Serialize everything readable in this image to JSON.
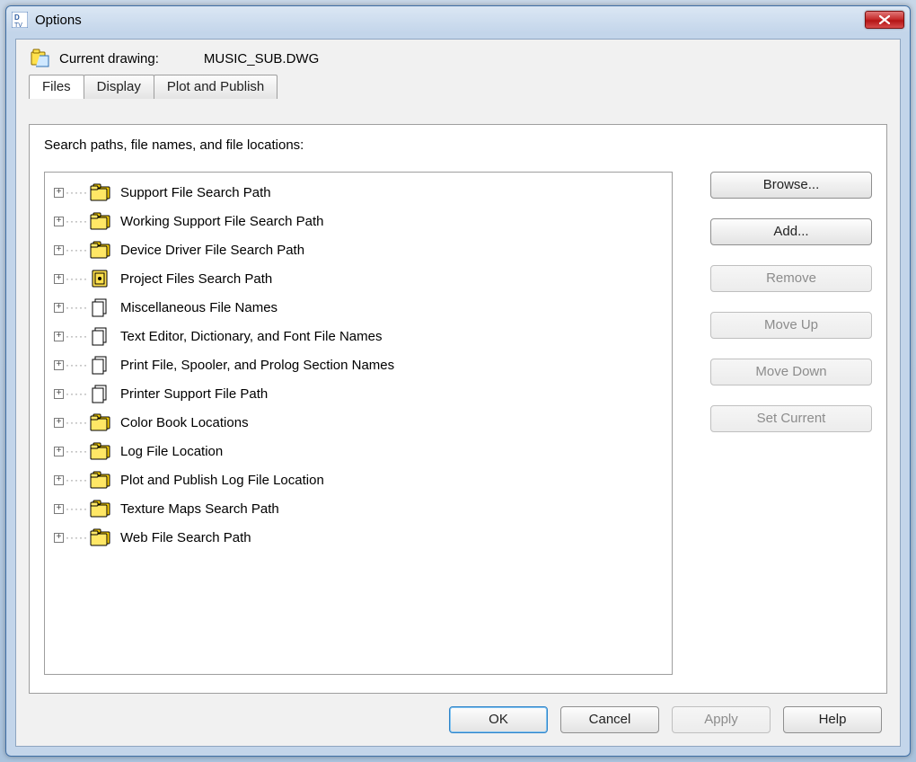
{
  "window": {
    "title": "Options"
  },
  "drawing": {
    "label": "Current drawing:",
    "name": "MUSIC_SUB.DWG"
  },
  "tabs": [
    {
      "label": "Files",
      "active": true
    },
    {
      "label": "Display",
      "active": false
    },
    {
      "label": "Plot and Publish",
      "active": false
    }
  ],
  "panel": {
    "header": "Search paths, file names, and file locations:"
  },
  "tree": [
    {
      "label": "Support File Search Path",
      "icon": "folder"
    },
    {
      "label": "Working Support File Search Path",
      "icon": "folder"
    },
    {
      "label": "Device Driver File Search Path",
      "icon": "folder"
    },
    {
      "label": "Project Files Search Path",
      "icon": "project"
    },
    {
      "label": "Miscellaneous File Names",
      "icon": "file"
    },
    {
      "label": "Text Editor, Dictionary, and Font File Names",
      "icon": "file"
    },
    {
      "label": "Print File, Spooler, and Prolog Section Names",
      "icon": "file"
    },
    {
      "label": "Printer Support File Path",
      "icon": "file"
    },
    {
      "label": "Color Book Locations",
      "icon": "folder"
    },
    {
      "label": "Log File Location",
      "icon": "folder"
    },
    {
      "label": "Plot and Publish Log File Location",
      "icon": "folder"
    },
    {
      "label": "Texture Maps Search Path",
      "icon": "folder"
    },
    {
      "label": "Web File Search Path",
      "icon": "folder"
    }
  ],
  "side_buttons": [
    {
      "label": "Browse...",
      "enabled": true
    },
    {
      "label": "Add...",
      "enabled": true
    },
    {
      "label": "Remove",
      "enabled": false
    },
    {
      "label": "Move Up",
      "enabled": false
    },
    {
      "label": "Move Down",
      "enabled": false
    },
    {
      "label": "Set Current",
      "enabled": false
    }
  ],
  "bottom_buttons": {
    "ok": "OK",
    "cancel": "Cancel",
    "apply": "Apply",
    "help": "Help"
  }
}
